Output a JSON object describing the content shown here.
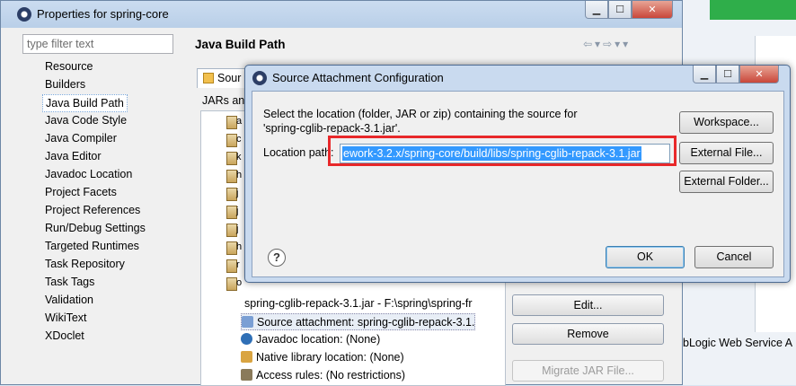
{
  "properties_window": {
    "title": "Properties for spring-core",
    "filter_placeholder": "type filter text",
    "nav_items": [
      "Resource",
      "Builders",
      "Java Build Path",
      "Java Code Style",
      "Java Compiler",
      "Java Editor",
      "Javadoc Location",
      "Project Facets",
      "Project References",
      "Run/Debug Settings",
      "Targeted Runtimes",
      "Task Repository",
      "Task Tags",
      "Validation",
      "WikiText",
      "XDoclet"
    ],
    "selected_nav": "Java Build Path",
    "section_title": "Java Build Path",
    "tab_label": "Sour",
    "jars_label": "JARs and",
    "jar_letters": [
      "a",
      "c",
      "k",
      "h",
      "j",
      "j",
      "j",
      "h",
      "r",
      "o"
    ],
    "selected_jar": "spring-cglib-repack-3.1.jar - F:\\spring\\spring-fr",
    "jar_children": [
      {
        "label": "Source attachment: spring-cglib-repack-3.1.",
        "icon": "source-attachment-icon"
      },
      {
        "label": "Javadoc location: (None)",
        "icon": "javadoc-icon"
      },
      {
        "label": "Native library location: (None)",
        "icon": "native-library-icon"
      },
      {
        "label": "Access rules: (No restrictions)",
        "icon": "access-rules-icon"
      }
    ],
    "buttons": {
      "edit": "Edit...",
      "remove": "Remove",
      "migrate": "Migrate JAR File..."
    },
    "weblogic_label": "bLogic Web Service A"
  },
  "dialog": {
    "title": "Source Attachment Configuration",
    "description_line1": "Select the location (folder, JAR or zip) containing the source for",
    "description_line2": "'spring-cglib-repack-3.1.jar'.",
    "location_label": "Location path:",
    "location_value": "ework-3.2.x/spring-core/build/libs/spring-cglib-repack-3.1.jar",
    "buttons": {
      "workspace": "Workspace...",
      "external_file": "External File...",
      "external_folder": "External Folder...",
      "ok": "OK",
      "cancel": "Cancel"
    },
    "help_symbol": "?"
  },
  "colors": {
    "selection": "#3399ff",
    "highlight_box": "#e8282a",
    "close_button": "#c9473a",
    "title_bar": "#c9daef"
  }
}
